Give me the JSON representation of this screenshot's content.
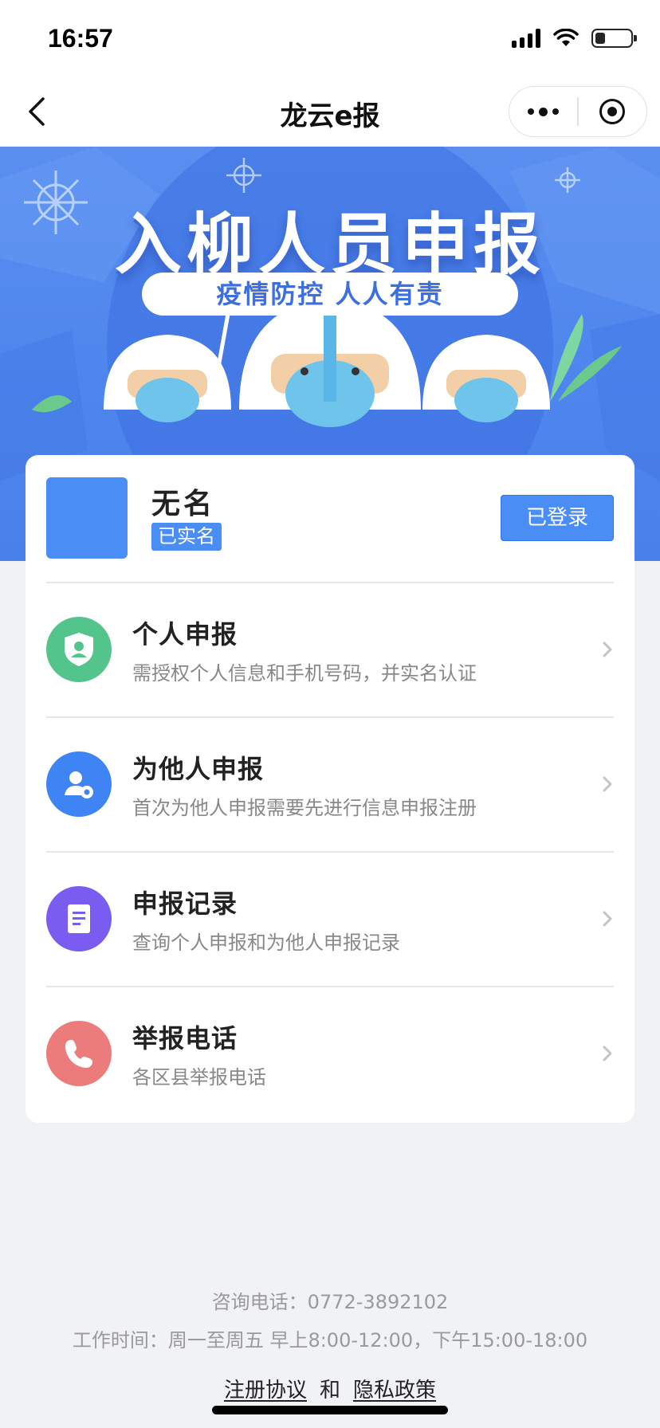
{
  "status_bar": {
    "time": "16:57"
  },
  "nav": {
    "title": "龙云e报"
  },
  "banner": {
    "title": "入柳人员申报",
    "slogan": "疫情防控 人人有责"
  },
  "user": {
    "name": "无名",
    "verified_label": "已实名",
    "login_label": "已登录"
  },
  "menu": [
    {
      "title": "个人申报",
      "subtitle": "需授权个人信息和手机号码，并实名认证",
      "icon": "shield-user-icon",
      "color": "#52c48c"
    },
    {
      "title": "为他人申报",
      "subtitle": "首次为他人申报需要先进行信息申报注册",
      "icon": "user-add-icon",
      "color": "#3e84f5"
    },
    {
      "title": "申报记录",
      "subtitle": "查询个人申报和为他人申报记录",
      "icon": "document-icon",
      "color": "#7a5cf0"
    },
    {
      "title": "举报电话",
      "subtitle": "各区县举报电话",
      "icon": "phone-icon",
      "color": "#ec7b7b"
    }
  ],
  "footer": {
    "hotline": "咨询电话：0772-3892102",
    "hours": "工作时间：周一至周五 早上8:00-12:00，下午15:00-18:00",
    "agreement_link": "注册协议",
    "and_text": "和",
    "privacy_link": "隐私政策"
  }
}
